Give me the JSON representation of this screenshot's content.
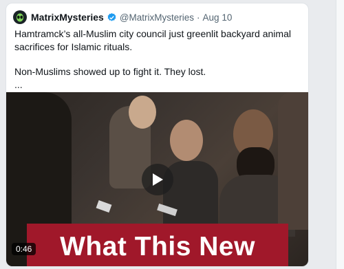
{
  "tweet": {
    "display_name": "MatrixMysteries",
    "handle": "@MatrixMysteries",
    "separator": "·",
    "date": "Aug 10",
    "text_line1": "Hamtramck’s all-Muslim city council just greenlit backyard animal sacrifices for Islamic rituals.",
    "text_line2": "Non-Muslims showed up to fight it. They lost.",
    "text_more": "..."
  },
  "video": {
    "duration": "0:46",
    "overlay_text": "What This New",
    "banner_color": "#a0182a"
  },
  "colors": {
    "verified": "#1d9bf0",
    "text_primary": "#0f1419",
    "text_secondary": "#536471"
  }
}
